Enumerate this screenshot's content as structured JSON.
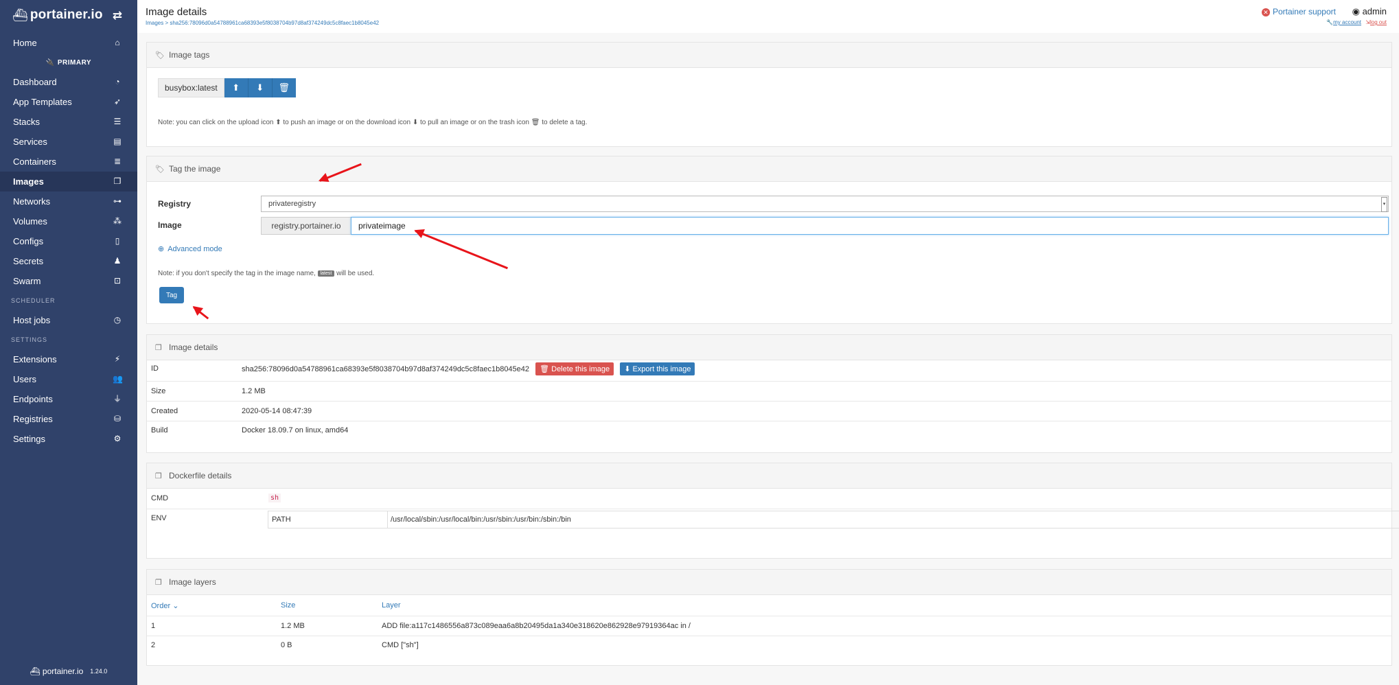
{
  "sidebar": {
    "brand": "portainer.io",
    "items": [
      {
        "label": "Home"
      },
      {
        "label": "Dashboard"
      },
      {
        "label": "App Templates"
      },
      {
        "label": "Stacks"
      },
      {
        "label": "Services"
      },
      {
        "label": "Containers"
      },
      {
        "label": "Images"
      },
      {
        "label": "Networks"
      },
      {
        "label": "Volumes"
      },
      {
        "label": "Configs"
      },
      {
        "label": "Secrets"
      },
      {
        "label": "Swarm"
      },
      {
        "label": "Host jobs"
      },
      {
        "label": "Extensions"
      },
      {
        "label": "Users"
      },
      {
        "label": "Endpoints"
      },
      {
        "label": "Registries"
      },
      {
        "label": "Settings"
      }
    ],
    "endpoint": "PRIMARY",
    "heading_scheduler": "SCHEDULER",
    "heading_settings": "SETTINGS",
    "footer_brand": "portainer.io",
    "version": "1.24.0"
  },
  "header": {
    "title": "Image details",
    "breadcrumb": "Images > sha256:78096d0a54788961ca68393e5f8038704b97d8af374249dc5c8faec1b8045e42",
    "support": "Portainer support",
    "user": "admin",
    "my_account": "my account",
    "log_out": "log out"
  },
  "image_tags": {
    "title": "Image tags",
    "tag": "busybox:latest",
    "note": "Note: you can click on the upload icon ⬆ to push an image or on the download icon ⬇ to pull an image or on the trash icon 🗑 to delete a tag."
  },
  "tag_image": {
    "title": "Tag the image",
    "registry_label": "Registry",
    "registry_value": "privateregistry",
    "image_label": "Image",
    "image_prefix": "registry.portainer.io",
    "image_value": "privateimage",
    "advanced_mode": "Advanced mode",
    "note_before": "Note: if you don't specify the tag in the image name,",
    "note_badge": "latest",
    "note_after": "will be used.",
    "tag_button": "Tag"
  },
  "image_details": {
    "title": "Image details",
    "id_label": "ID",
    "id_value": "sha256:78096d0a54788961ca68393e5f8038704b97d8af374249dc5c8faec1b8045e42",
    "delete_button": "Delete this image",
    "export_button": "Export this image",
    "size_label": "Size",
    "size_value": "1.2 MB",
    "created_label": "Created",
    "created_value": "2020-05-14 08:47:39",
    "build_label": "Build",
    "build_value": "Docker 18.09.7 on linux, amd64"
  },
  "dockerfile": {
    "title": "Dockerfile details",
    "cmd_label": "CMD",
    "cmd_value": "sh",
    "env_label": "ENV",
    "env_key": "PATH",
    "env_value": "/usr/local/sbin:/usr/local/bin:/usr/sbin:/usr/bin:/sbin:/bin"
  },
  "layers": {
    "title": "Image layers",
    "col_order": "Order",
    "col_size": "Size",
    "col_layer": "Layer",
    "rows": [
      {
        "order": "1",
        "size": "1.2 MB",
        "layer": "ADD file:a117c1486556a873c089eaa6a8b20495da1a340e318620e862928e97919364ac in /"
      },
      {
        "order": "2",
        "size": "0 B",
        "layer": "CMD [\"sh\"]"
      }
    ]
  },
  "colors": {
    "sidebar": "#30426a",
    "accent": "#337ab7",
    "danger": "#d9534f",
    "annotation": "#e8141a"
  }
}
